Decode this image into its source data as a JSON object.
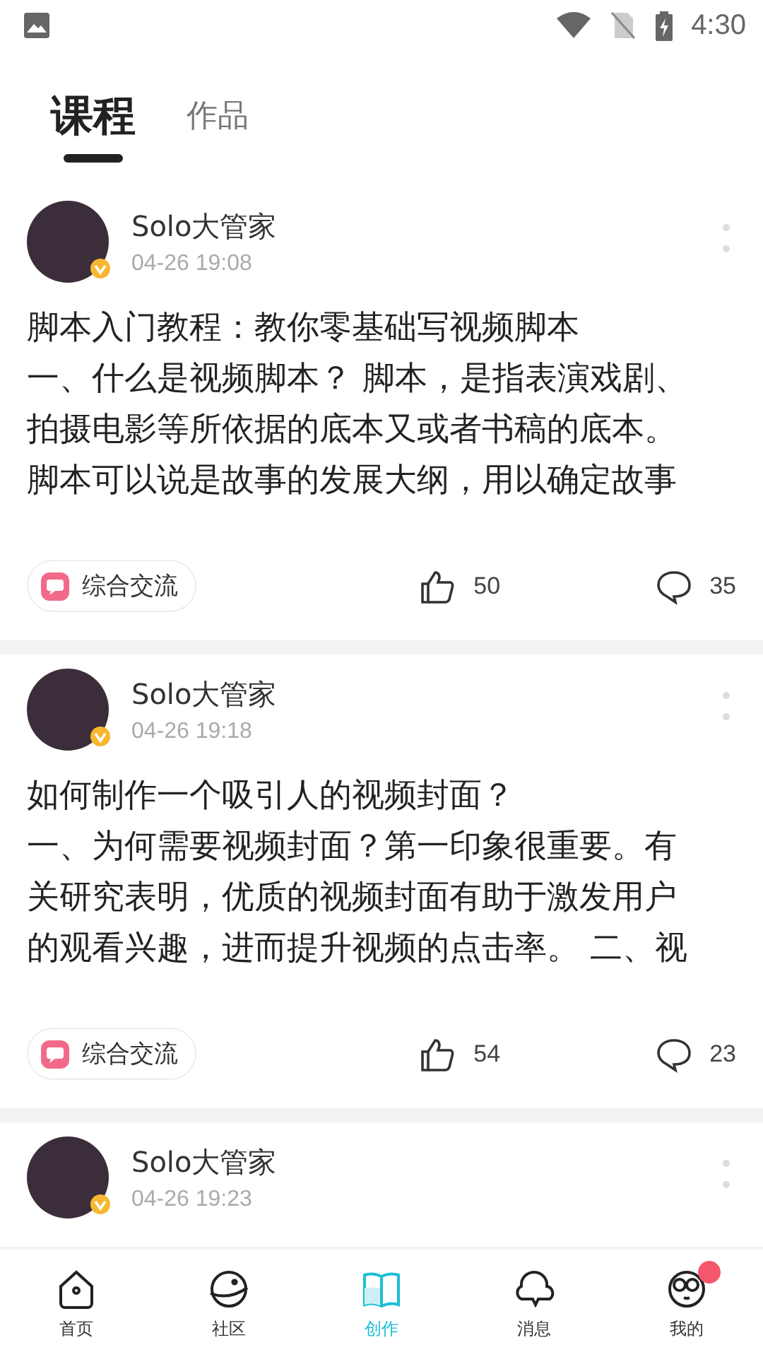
{
  "status_bar": {
    "time": "4:30"
  },
  "tabs": [
    {
      "label": "课程",
      "selected": true
    },
    {
      "label": "作品",
      "selected": false
    }
  ],
  "posts": [
    {
      "author": "Solo大管家",
      "time": "04-26 19:08",
      "lines": [
        "脚本入门教程：教你零基础写视频脚本",
        "一、什么是视频脚本？ 脚本，是指表演戏剧、",
        "拍摄电影等所依据的底本又或者书稿的底本。",
        "脚本可以说是故事的发展大纲，用以确定故事"
      ],
      "tag": "综合交流",
      "likes": "50",
      "comments": "35"
    },
    {
      "author": "Solo大管家",
      "time": "04-26 19:18",
      "lines": [
        "如何制作一个吸引人的视频封面？",
        "一、为何需要视频封面？第一印象很重要。有",
        "关研究表明，优质的视频封面有助于激发用户",
        "的观看兴趣，进而提升视频的点击率。 二、视"
      ],
      "tag": "综合交流",
      "likes": "54",
      "comments": "23"
    },
    {
      "author": "Solo大管家",
      "time": "04-26 19:23"
    }
  ],
  "bottom_nav": [
    {
      "label": "首页",
      "kind": "home",
      "selected": false,
      "badge": false
    },
    {
      "label": "社区",
      "kind": "planet",
      "selected": false,
      "badge": false
    },
    {
      "label": "创作",
      "kind": "book",
      "selected": true,
      "badge": false
    },
    {
      "label": "消息",
      "kind": "bubble",
      "selected": false,
      "badge": false
    },
    {
      "label": "我的",
      "kind": "face",
      "selected": false,
      "badge": true
    }
  ]
}
